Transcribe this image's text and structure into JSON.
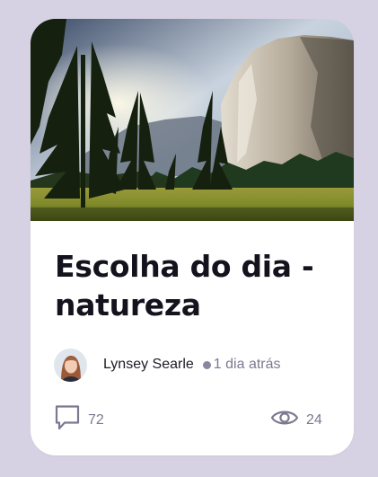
{
  "card": {
    "image_alt": "Vale com pinheiros e uma grande parede de granito",
    "title": "Escolha do dia - natureza",
    "author": {
      "name": "Lynsey Searle",
      "time": "1 dia atrás"
    },
    "stats": {
      "comments": "72",
      "views": "24"
    }
  },
  "icons": {
    "comments": "speech-bubble-icon",
    "views": "eye-icon"
  },
  "colors": {
    "background": "#d6d2e3",
    "card": "#ffffff",
    "title": "#14131d",
    "muted": "#7d7990",
    "dot": "#8a86a0"
  }
}
